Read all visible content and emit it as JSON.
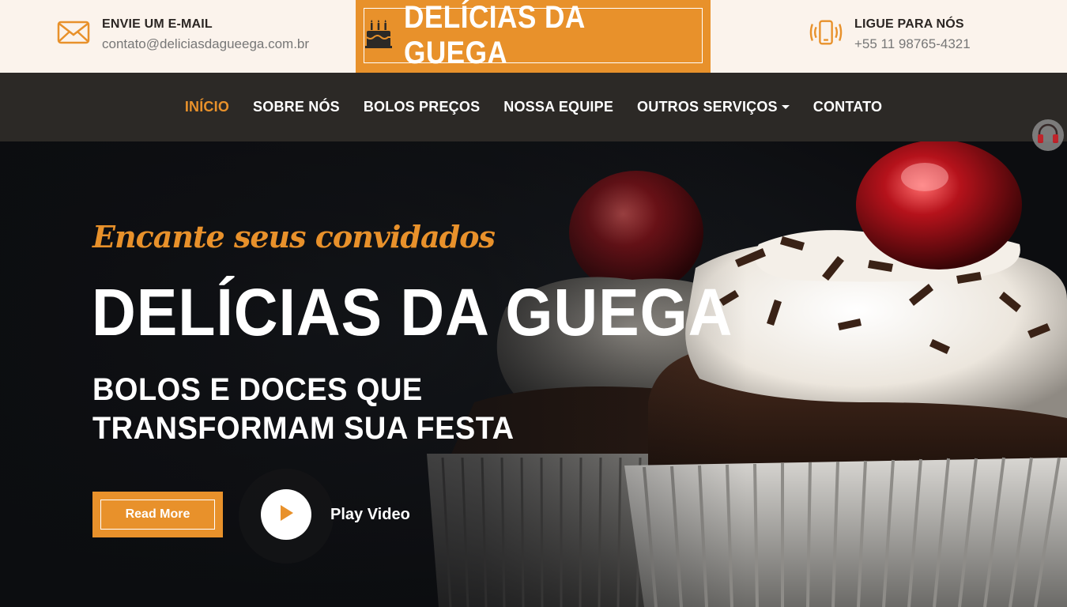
{
  "brand": {
    "name": "DELÍCIAS DA GUEGA",
    "accent": "#e8912b",
    "dark": "#2c2926"
  },
  "contact_email": {
    "icon": "envelope-icon",
    "title": "ENVIE UM E-MAIL",
    "value": "contato@deliciasdagueega.com.br"
  },
  "contact_phone": {
    "icon": "phone-icon",
    "title": "LIGUE PARA NÓS",
    "value": "+55 11 98765-4321"
  },
  "nav": {
    "items": [
      {
        "label": "INÍCIO",
        "active": true
      },
      {
        "label": "SOBRE NÓS"
      },
      {
        "label": "BOLOS PREÇOS"
      },
      {
        "label": "NOSSA EQUIPE"
      },
      {
        "label": "OUTROS SERVIÇOS",
        "dropdown": true
      },
      {
        "label": "CONTATO"
      }
    ]
  },
  "hero": {
    "tagline": "Encante seus convidados",
    "title": "DELÍCIAS DA GUEGA",
    "subtitle": "BOLOS E DOCES QUE TRANSFORMAM SUA FESTA",
    "read_more": "Read More",
    "play_video": "Play Video"
  },
  "accessibility": {
    "icon": "headphones-icon"
  }
}
